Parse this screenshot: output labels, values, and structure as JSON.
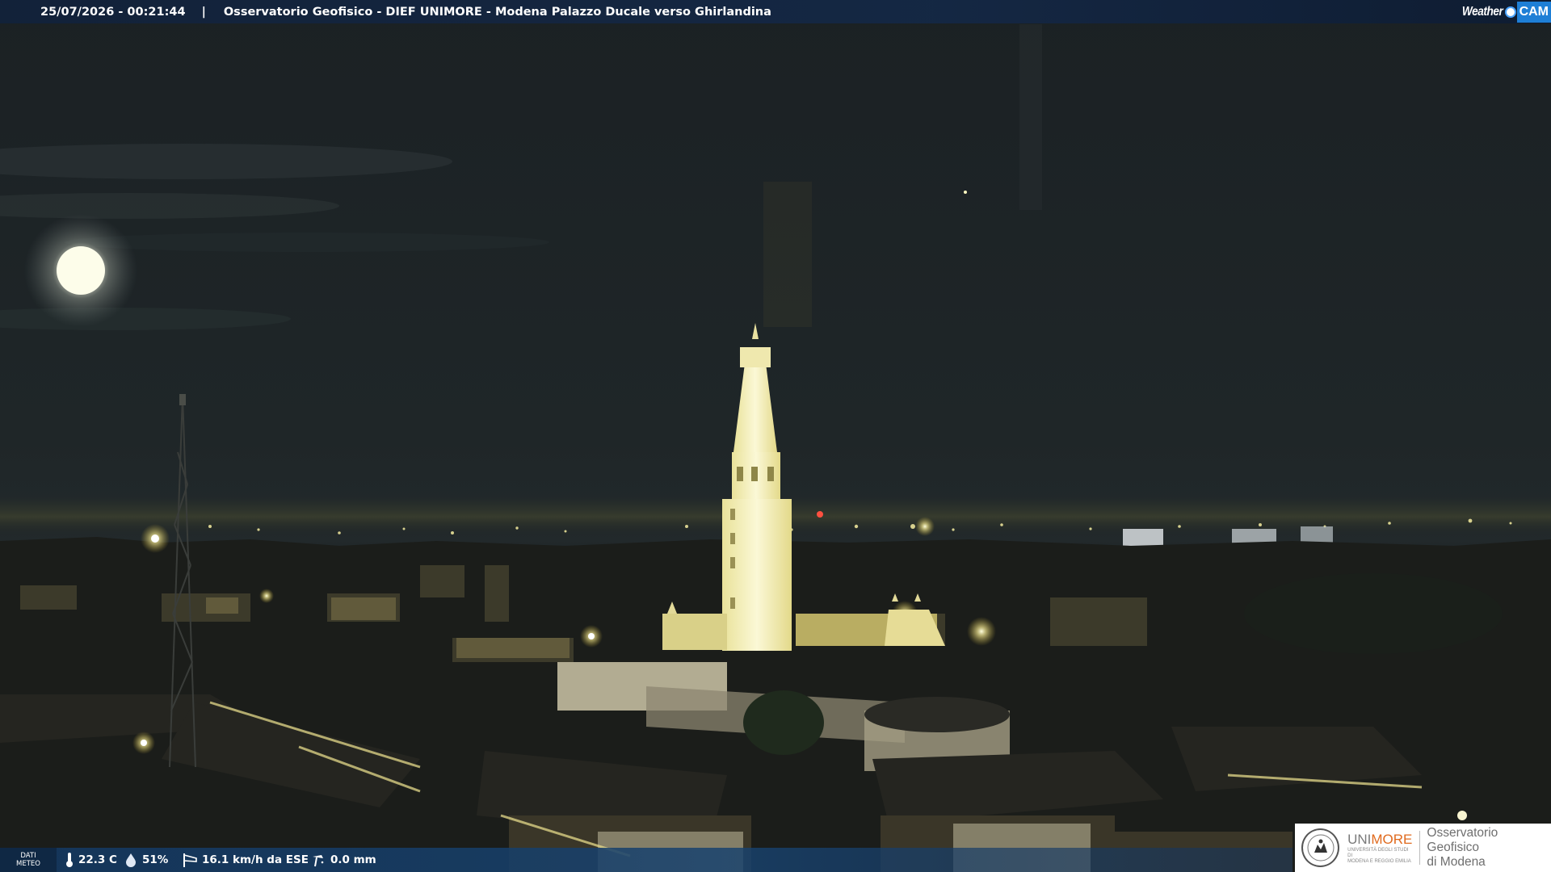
{
  "header": {
    "datetime": "25/07/2026 - 00:21:44",
    "separator": "|",
    "caption": "Osservatorio Geofisico - DIEF UNIMORE - Modena Palazzo Ducale verso Ghirlandina"
  },
  "brand": {
    "weather_text": "Weather",
    "cam_text": "CAM"
  },
  "weather": {
    "dati_label_line1": "DATI",
    "dati_label_line2": "METEO",
    "temperature": "22.3 C",
    "humidity": "51%",
    "wind": "16.1 km/h da ESE",
    "rain": "0.0 mm",
    "icons": [
      "thermometer-icon",
      "humidity-drop-icon",
      "wind-sock-icon",
      "rain-gauge-icon"
    ]
  },
  "footer_logo": {
    "uni_prefix": "UNI",
    "uni_suffix": "MORE",
    "uni_sub_line1": "UNIVERSITÀ DEGLI STUDI DI",
    "uni_sub_line2": "MODENA E REGGIO EMILIA",
    "observatory_line1": "Osservatorio Geofisico",
    "observatory_line2": "di Modena"
  },
  "colors": {
    "bar_blue": "#14365c",
    "cam_blue": "#1e7fd6",
    "unimore_orange": "#e06a1e",
    "tower_light": "#f3efb0"
  }
}
